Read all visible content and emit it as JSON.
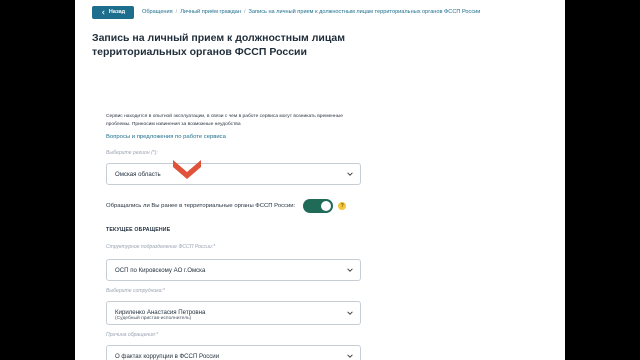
{
  "header": {
    "back_label": "Назад",
    "breadcrumbs": [
      "Обращения",
      "Личный приём граждан",
      "Запись на личный прием к должностным лицам территориальных органов ФССП России"
    ]
  },
  "page_title": "Запись на личный прием к должностным лицам территориальных органов ФССП России",
  "notice": "Сервис находится в опытной эксплуатации, в связи с чем в работе сервиса могут возникать временные проблемы. Приносим извинения за возможные неудобства",
  "suggest_link": "Вопросы и предложения по работе сервиса",
  "region": {
    "label": "Выберите регион (*):",
    "value": "Омская область"
  },
  "prior_contact": {
    "label": "Обращались ли Вы ранее в территориальные органы ФССП России:",
    "state": "on",
    "help_icon": "?"
  },
  "section_title": "ТЕКУЩЕЕ ОБРАЩЕНИЕ",
  "division": {
    "label": "Структурное подразделение ФССП России:*",
    "value": "ОСП по Кировскому АО г.Омска"
  },
  "employee": {
    "label": "Выберите сотрудника:*",
    "value": "Кириленко Анастасия Петровна",
    "subtext": "(Судебный пристав-исполнитель)"
  },
  "reason": {
    "label": "Причина обращения:*",
    "value": "О фактах коррупции в ФССП России"
  },
  "colors": {
    "accent": "#1d6e8c",
    "toggle_on": "#1f6b58",
    "marker": "#e0533a",
    "help": "#f3c63d"
  }
}
